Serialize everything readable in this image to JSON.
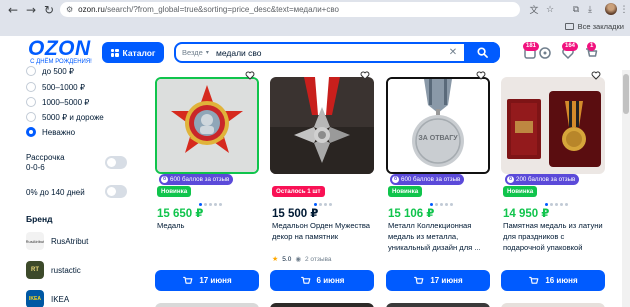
{
  "browser": {
    "url_host": "ozon.ru",
    "url_path": "/search/?from_global=true&sorting=price_desc&text=медали+сво",
    "bookmarks_label": "Все закладки"
  },
  "header": {
    "logo_text": "OZON",
    "logo_subtitle": "С ДНЁМ РОЖДЕНИЯ!",
    "catalog_label": "Каталог",
    "search_scope": "Везде",
    "search_value": "медали сво",
    "badges": {
      "orders": "181",
      "favorites": "164",
      "cart": "1"
    }
  },
  "sidebar": {
    "price_options": [
      {
        "label": "до 500 ₽",
        "selected": false
      },
      {
        "label": "500–1000 ₽",
        "selected": false
      },
      {
        "label": "1000–5000 ₽",
        "selected": false
      },
      {
        "label": "5000 ₽ и дороже",
        "selected": false
      },
      {
        "label": "Неважно",
        "selected": true
      }
    ],
    "installment_label_1": "Рассрочка",
    "installment_label_2": "0-0-6",
    "zero_percent_label": "0% до 140 дней",
    "brand_title": "Бренд",
    "brands": [
      {
        "name": "RusAtribut",
        "logo_text": "RusAtribut"
      },
      {
        "name": "rustactic",
        "logo_text": "RT"
      },
      {
        "name": "IKEA",
        "logo_text": "IKEA"
      }
    ]
  },
  "products": [
    {
      "promo": "600 баллов за отзыв",
      "tag": "Новинка",
      "price": "15 650 ₽",
      "title": "Медаль",
      "rating": "",
      "reviews": "",
      "delivery": "17 июня"
    },
    {
      "promo": "",
      "tag": "Осталось 1 шт",
      "price": "15 500 ₽",
      "title": "Медальон Орден Мужества декор на памятник",
      "rating": "5.0",
      "reviews": "2 отзыва",
      "delivery": "6 июня"
    },
    {
      "promo": "600 баллов за отзыв",
      "tag": "Новинка",
      "price": "15 106 ₽",
      "title": "Металл Коллекционная медаль из металла, уникальный дизайн для ...",
      "rating": "",
      "reviews": "",
      "delivery": "17 июня"
    },
    {
      "promo": "200 баллов за отзыв",
      "tag": "Новинка",
      "price": "14 950 ₽",
      "title": "Памятная медаль из латуни для праздников с подарочной упаковкой",
      "rating": "",
      "reviews": "",
      "delivery": "16 июня"
    }
  ],
  "medal_inscription": "ЗА ОТВАГУ",
  "colors": {
    "accent": "#005bff",
    "price_green": "#10c44c",
    "promo_purple": "#5b4ad9",
    "badge_pink": "#f1117e"
  }
}
